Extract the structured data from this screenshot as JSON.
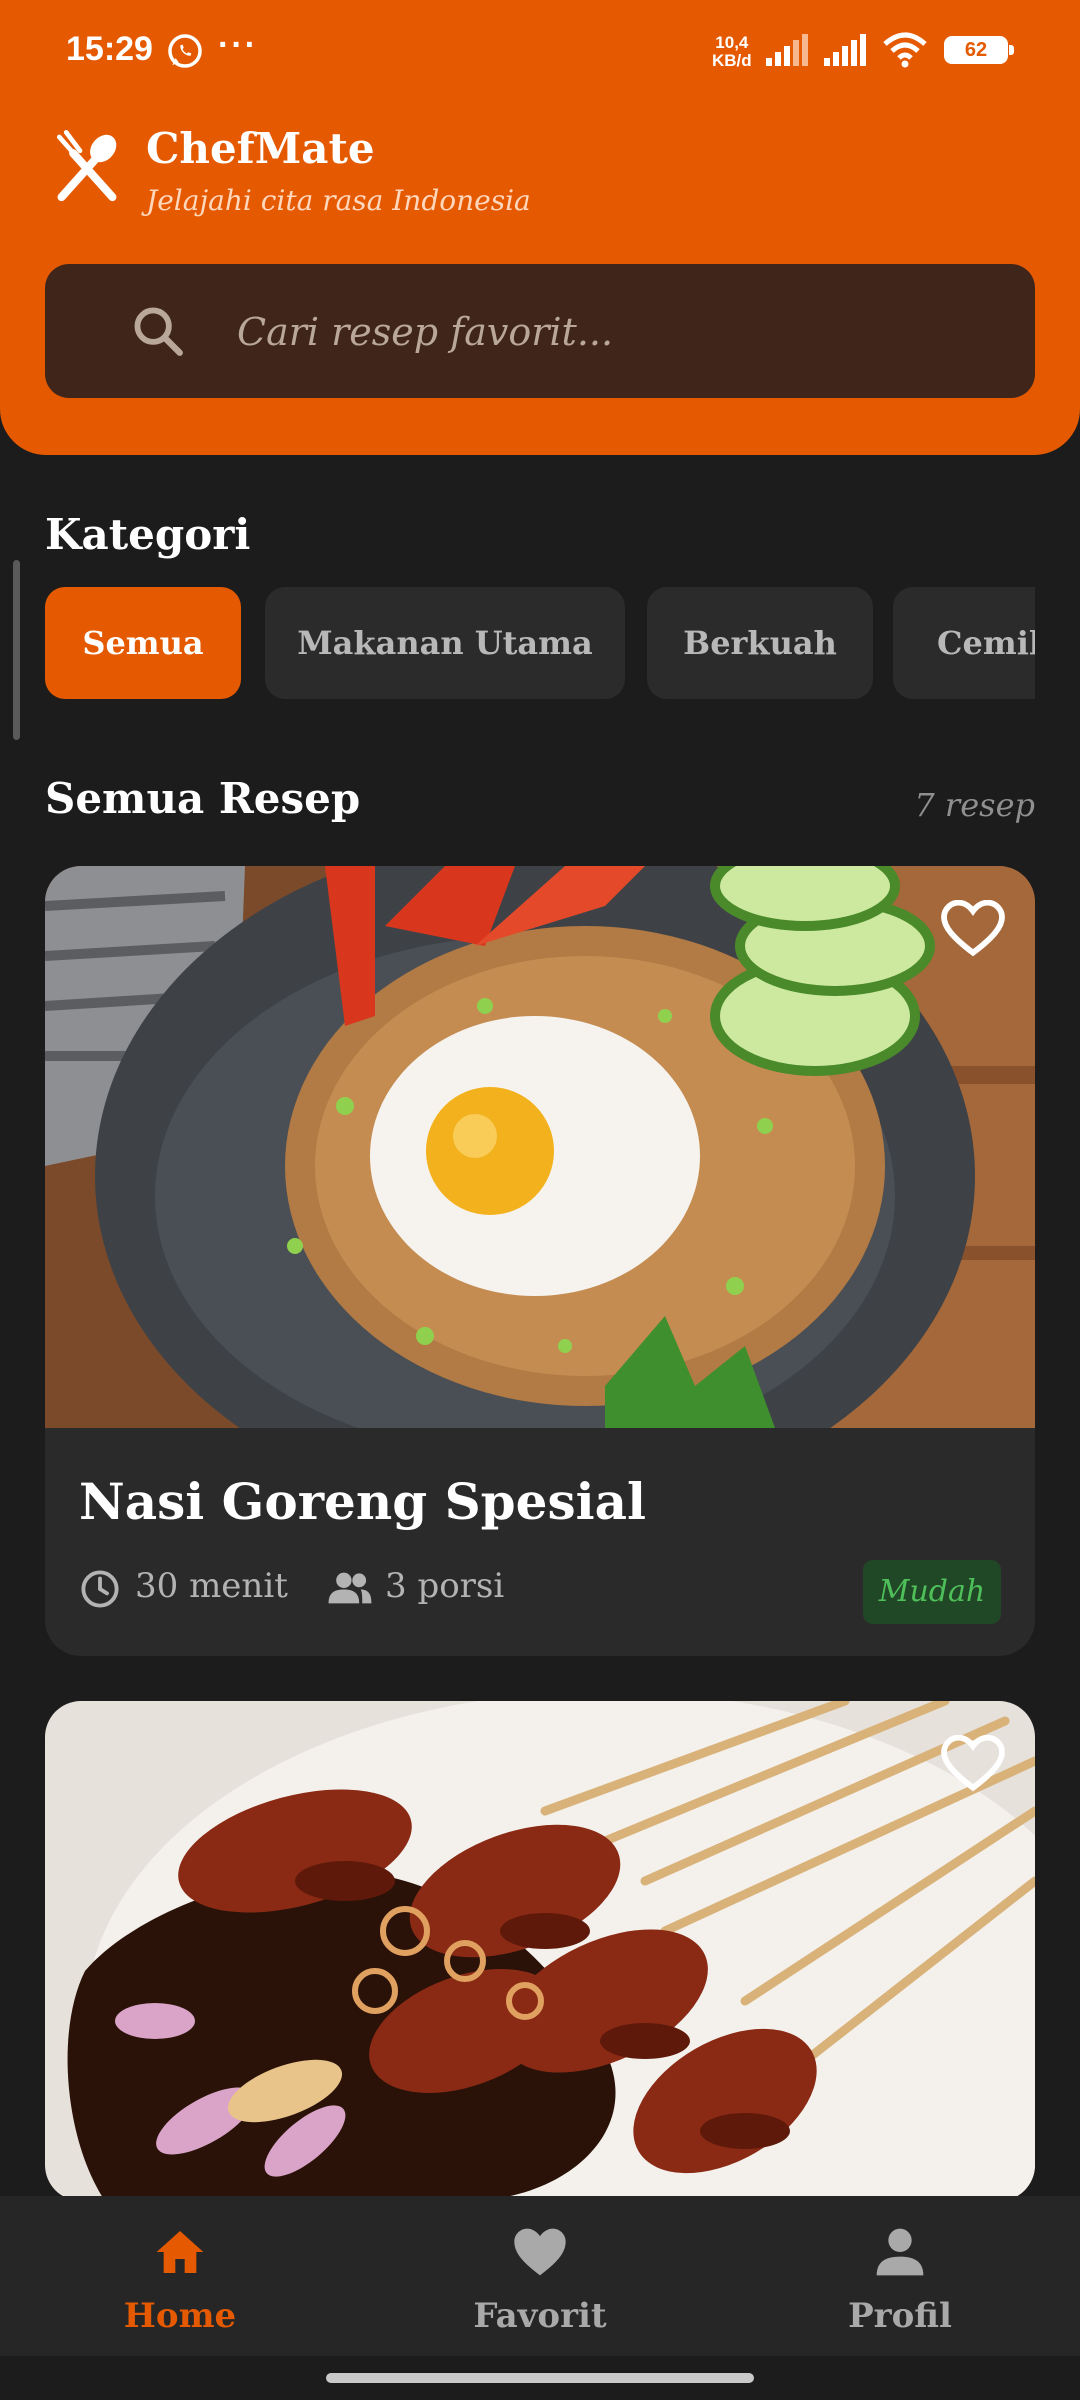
{
  "status_bar": {
    "time": "15:29",
    "dots": "···",
    "net_speed_value": "10,4",
    "net_speed_unit": "KB/d",
    "battery": "62"
  },
  "header": {
    "app_name": "ChefMate",
    "tagline": "Jelajahi cita rasa Indonesia"
  },
  "search": {
    "placeholder": "Cari resep favorit..."
  },
  "categories": {
    "title": "Kategori",
    "items": [
      {
        "label": "Semua",
        "active": true
      },
      {
        "label": "Makanan Utama",
        "active": false
      },
      {
        "label": "Berkuah",
        "active": false
      },
      {
        "label": "Cemila",
        "active": false
      }
    ]
  },
  "recipes": {
    "title": "Semua Resep",
    "count": "7 resep",
    "items": [
      {
        "name": "Nasi Goreng Spesial",
        "time": "30 menit",
        "servings": "3 porsi",
        "difficulty": "Mudah",
        "image": "fried-rice-with-fried-egg"
      },
      {
        "name": "",
        "image": "chicken-satay-skewers"
      }
    ]
  },
  "bottom_nav": {
    "items": [
      {
        "label": "Home",
        "icon": "home-icon",
        "active": true
      },
      {
        "label": "Favorit",
        "icon": "heart-icon",
        "active": false
      },
      {
        "label": "Profil",
        "icon": "person-icon",
        "active": false
      }
    ]
  },
  "colors": {
    "primary": "#e55a00",
    "background": "#1c1c1c",
    "card": "#2a2a2a",
    "search_bg": "#40261a",
    "easy_badge": "#4fbf5a"
  }
}
